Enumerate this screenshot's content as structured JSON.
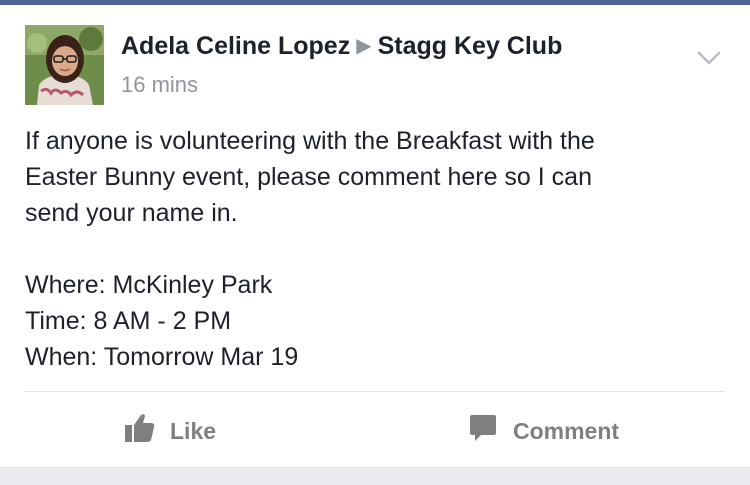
{
  "post": {
    "author": "Adela Celine Lopez",
    "group": "Stagg Key Club",
    "timestamp": "16 mins",
    "body": {
      "paragraph1": [
        "If anyone is volunteering with the Breakfast with the",
        "Easter Bunny event, please comment here so I can",
        "send your name in."
      ],
      "details": [
        "Where: McKinley Park",
        "Time: 8 AM - 2 PM",
        "When: Tomorrow Mar 19"
      ]
    }
  },
  "actions": {
    "like_label": "Like",
    "comment_label": "Comment"
  },
  "icons": {
    "separator": "triangle-right-icon",
    "menu": "chevron-down-icon",
    "like": "thumbs-up-icon",
    "comment": "speech-bubble-icon"
  },
  "colors": {
    "accent": "#4b6597",
    "text": "#1d2129",
    "muted": "#90949c",
    "action": "#7f7f7f"
  }
}
